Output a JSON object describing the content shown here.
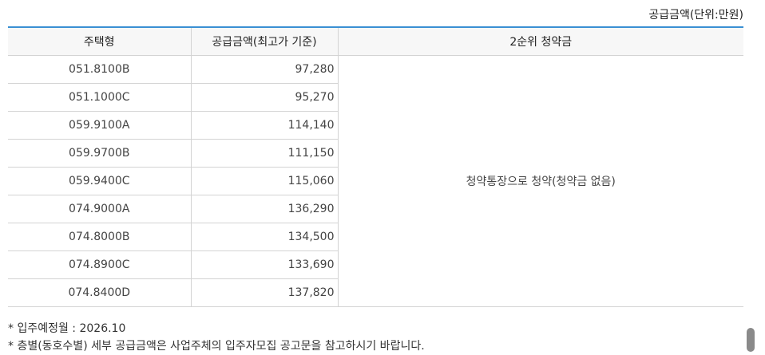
{
  "unit_label": "공급금액(단위:만원)",
  "table": {
    "headers": {
      "type": "주택형",
      "amount": "공급금액(최고가 기준)",
      "deposit": "2순위 청약금"
    },
    "rows": [
      {
        "type": "051.8100B",
        "amount": "97,280"
      },
      {
        "type": "051.1000C",
        "amount": "95,270"
      },
      {
        "type": "059.9100A",
        "amount": "114,140"
      },
      {
        "type": "059.9700B",
        "amount": "111,150"
      },
      {
        "type": "059.9400C",
        "amount": "115,060"
      },
      {
        "type": "074.9000A",
        "amount": "136,290"
      },
      {
        "type": "074.8000B",
        "amount": "134,500"
      },
      {
        "type": "074.8900C",
        "amount": "133,690"
      },
      {
        "type": "074.8400D",
        "amount": "137,820"
      }
    ],
    "deposit_note": "청약통장으로 청약(청약금 없음)"
  },
  "notes": [
    "* 입주예정월 : 2026.10",
    "* 층별(동호수별) 세부 공급금액은 사업주체의 입주자모집 공고문을 참고하시기 바랍니다."
  ]
}
